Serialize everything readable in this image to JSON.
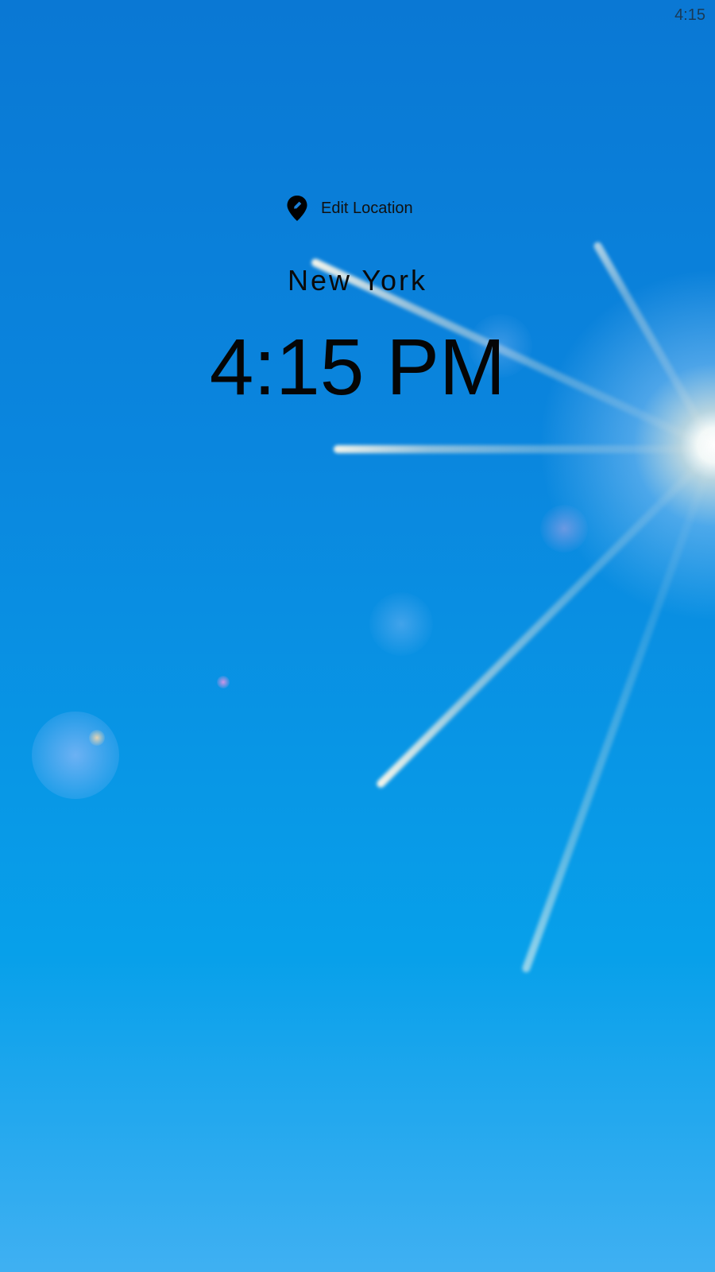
{
  "status_bar": {
    "time": "4:15"
  },
  "location": {
    "edit_label": "Edit Location",
    "icon": "location-pin-edit-icon",
    "city": "New York",
    "time": "4:15 PM"
  },
  "colors": {
    "sky_top": "#0a78d4",
    "sky_bottom": "#3fb0f2",
    "text": "#000000"
  }
}
